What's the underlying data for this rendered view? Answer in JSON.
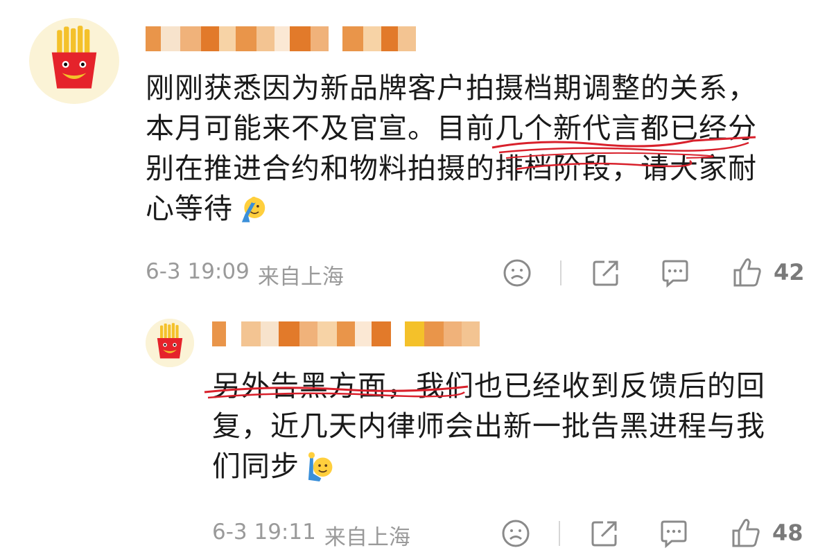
{
  "comments": [
    {
      "text_lines": [
        "刚刚获悉因为新品牌客户拍摄档期调整的关系，",
        "本月可能来不及官宣。目前几个新代言都已经分",
        "别在推进合约和物料拍摄的排档阶段，请大家耐",
        "心等待"
      ],
      "emoji": "salute-emoji",
      "time": "6-3 19:09",
      "location": "来自上海",
      "likes": "42"
    },
    {
      "text_lines": [
        "另外告黑方面，我们也已经收到反馈后的回",
        "复，近几天内律师会出新一批告黑进程与我",
        "们同步"
      ],
      "emoji": "raising-hand-emoji",
      "time": "6-3 19:11",
      "location": "来自上海",
      "likes": "48"
    }
  ],
  "icons": [
    "sad-face-icon",
    "share-icon",
    "comment-icon",
    "thumbs-up-icon"
  ],
  "colors": {
    "accent_scribble": "#d8202b",
    "meta_text": "#9a9a9a",
    "pixelated_name": [
      "#e27a2a",
      "#f0b27a",
      "#f7d3a6",
      "#e9954a"
    ]
  }
}
